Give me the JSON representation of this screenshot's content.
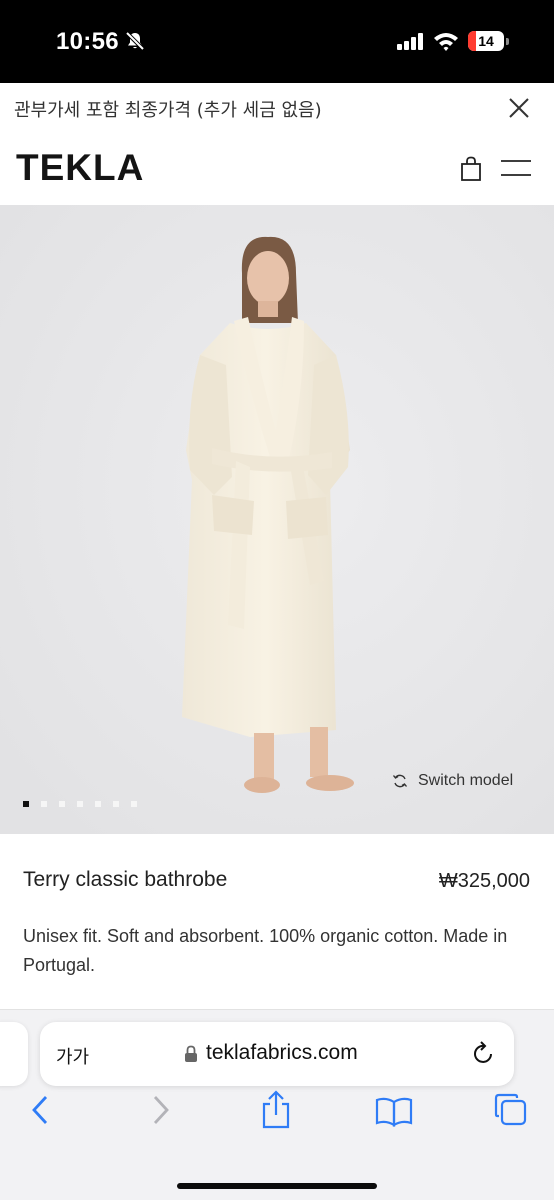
{
  "status_bar": {
    "time": "10:56",
    "battery_level": "14",
    "bell_icon": "bell-slash-icon",
    "signal_icon": "cellular-signal-icon",
    "wifi_icon": "wifi-icon"
  },
  "banner": {
    "text": "관부가세 포함 최종가격 (추가 세금 없음)",
    "close_icon": "close-icon"
  },
  "header": {
    "logo": "TEKLA",
    "bag_icon": "shopping-bag-icon",
    "menu_icon": "hamburger-menu-icon"
  },
  "hero": {
    "switch_model_label": "Switch model",
    "switch_icon": "refresh-cycle-icon",
    "carousel_total": 7,
    "carousel_active_index": 0
  },
  "product": {
    "name": "Terry classic bathrobe",
    "price": "₩325,000",
    "description": "Unisex fit. Soft and absorbent. 100% organic cotton. Made in Portugal."
  },
  "browser": {
    "text_size_label": "가가",
    "url": "teklafabrics.com",
    "lock_icon": "lock-icon",
    "reload_icon": "reload-icon",
    "toolbar_icons": [
      "back-chevron-icon",
      "forward-chevron-icon",
      "share-icon",
      "bookmarks-book-icon",
      "tabs-icon"
    ]
  },
  "colors": {
    "accent_blue": "#2f7cf6",
    "status_bar_bg": "#000000",
    "battery_low": "#ff3b30",
    "page_bg": "#ffffff",
    "hero_bg": "#e6e6e8"
  }
}
